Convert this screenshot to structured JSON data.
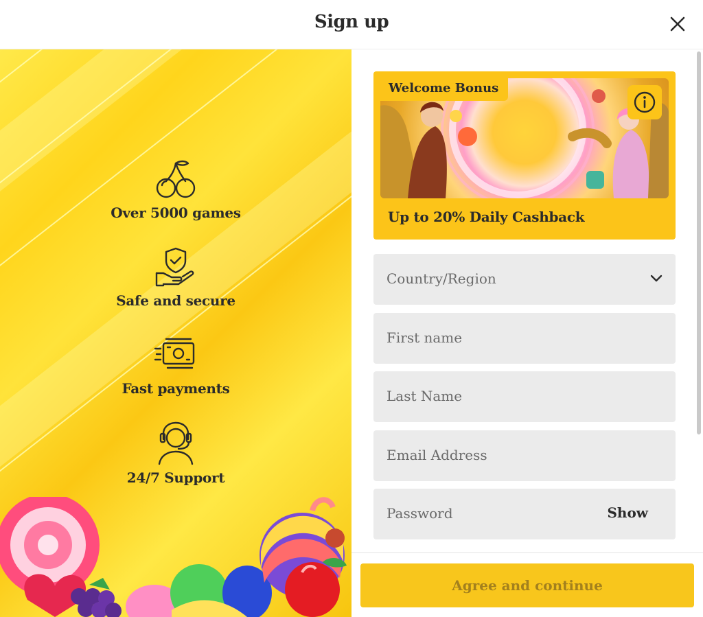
{
  "header": {
    "title": "Sign up",
    "close_icon": "close-icon"
  },
  "features": [
    {
      "icon": "cherries-icon",
      "label": "Over 5000 games"
    },
    {
      "icon": "shield-hand-icon",
      "label": "Safe and secure"
    },
    {
      "icon": "cash-icon",
      "label": "Fast payments"
    },
    {
      "icon": "headset-support-icon",
      "label": "24/7 Support"
    }
  ],
  "bonus": {
    "badge": "Welcome Bonus",
    "offer": "Up to 20% Daily Cashback",
    "info_icon": "info-icon"
  },
  "form": {
    "country": {
      "placeholder": "Country/Region",
      "icon": "chevron-down-icon"
    },
    "first_name": {
      "placeholder": "First name"
    },
    "last_name": {
      "placeholder": "Last Name"
    },
    "email": {
      "placeholder": "Email Address"
    },
    "password": {
      "placeholder": "Password",
      "toggle": "Show"
    }
  },
  "submit": {
    "label": "Agree and continue"
  },
  "colors": {
    "accent": "#fcc419",
    "button": "#f8c61c",
    "button_text": "#a3801d",
    "field_bg": "#ebebeb"
  }
}
